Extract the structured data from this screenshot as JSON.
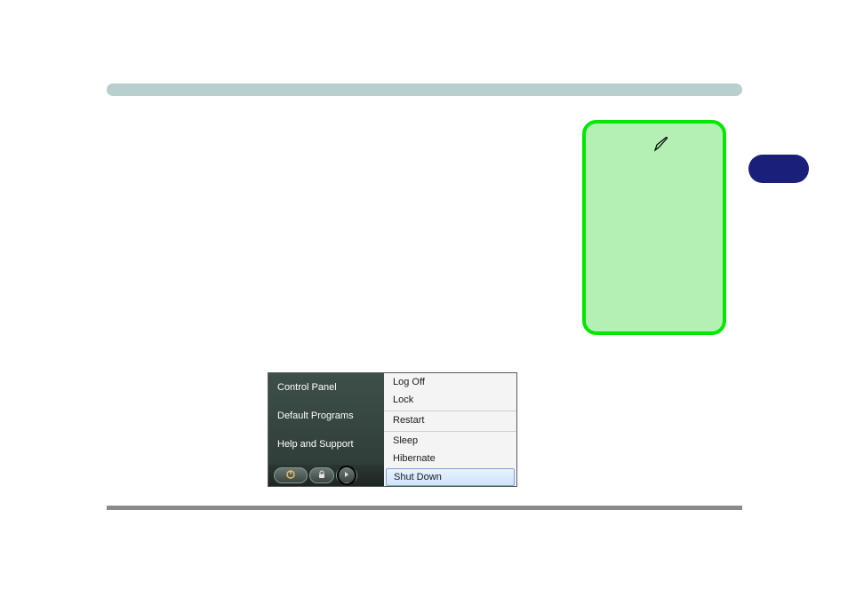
{
  "start_menu": {
    "left_items": [
      {
        "label": "Control Panel"
      },
      {
        "label": "Default Programs"
      },
      {
        "label": "Help and Support"
      }
    ],
    "right_items": [
      {
        "label": "Log Off"
      },
      {
        "label": "Lock"
      },
      {
        "label": "Restart"
      },
      {
        "label": "Sleep"
      },
      {
        "label": "Hibernate"
      },
      {
        "label": "Shut Down",
        "highlighted": true
      }
    ],
    "bottom_icons": {
      "power": "power-icon",
      "lock": "lock-icon",
      "arrow": "arrow-icon"
    }
  }
}
